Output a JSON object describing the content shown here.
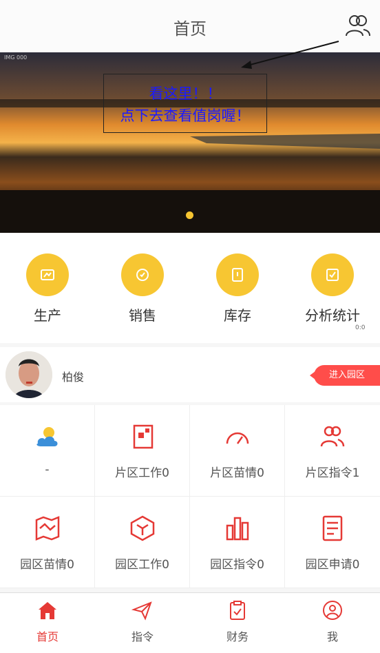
{
  "header": {
    "title": "首页"
  },
  "banner": {
    "meta_text": "IMG 000",
    "note_line1": "看这里！！",
    "note_line2": "点下去查看值岗喔！"
  },
  "quick_menu": [
    {
      "label": "生产",
      "icon": "production-icon"
    },
    {
      "label": "销售",
      "icon": "sales-icon"
    },
    {
      "label": "库存",
      "icon": "inventory-icon"
    },
    {
      "label": "分析统计",
      "icon": "analytics-icon"
    }
  ],
  "quick_badge": "0:0",
  "profile": {
    "name": "柏俊",
    "enter_label": "进入园区"
  },
  "grid": [
    {
      "label": "-",
      "icon": "weather-icon"
    },
    {
      "label": "片区工作0",
      "icon": "district-work-icon"
    },
    {
      "label": "片区苗情0",
      "icon": "district-seedling-icon"
    },
    {
      "label": "片区指令1",
      "icon": "district-command-icon"
    },
    {
      "label": "园区苗情0",
      "icon": "park-seedling-icon"
    },
    {
      "label": "园区工作0",
      "icon": "park-work-icon"
    },
    {
      "label": "园区指令0",
      "icon": "park-command-icon"
    },
    {
      "label": "园区申请0",
      "icon": "park-application-icon"
    }
  ],
  "tabs": [
    {
      "label": "首页",
      "icon": "home-icon",
      "active": true
    },
    {
      "label": "指令",
      "icon": "send-icon",
      "active": false
    },
    {
      "label": "财务",
      "icon": "clipboard-icon",
      "active": false
    },
    {
      "label": "我",
      "icon": "user-icon",
      "active": false
    }
  ],
  "colors": {
    "accent_yellow": "#f7c632",
    "accent_red": "#e53935"
  }
}
